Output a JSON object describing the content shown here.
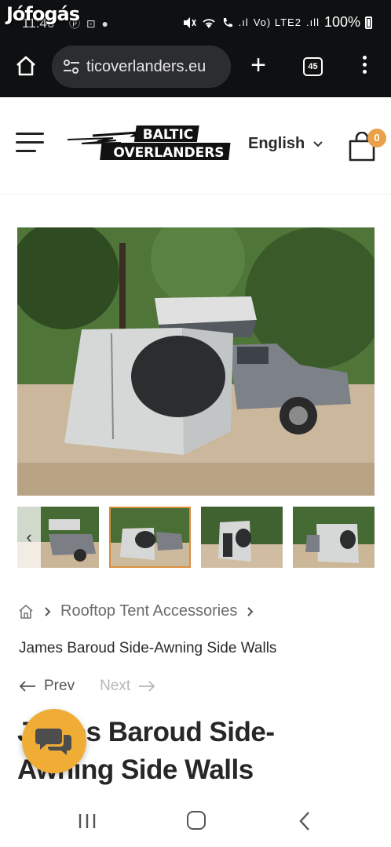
{
  "status_bar": {
    "watermark": "Jófogás",
    "time": "11:46",
    "left_icons": "ⓟ ⊡ ●",
    "network": "Vo) LTE2",
    "battery": "100%"
  },
  "browser": {
    "url": "ticoverlanders.eu",
    "tab_count": "45"
  },
  "header": {
    "logo_line1": "BALTIC",
    "logo_line2": "OVERLANDERS",
    "language": "English",
    "cart_count": "0"
  },
  "gallery": {
    "thumbnail_count": 4,
    "active_thumbnail": 2
  },
  "breadcrumb": {
    "category": "Rooftop Tent Accessories"
  },
  "product": {
    "subtitle": "James Baroud Side-Awning Side Walls",
    "title": "James Baroud Side-Awning Side Walls"
  },
  "pager": {
    "prev": "Prev",
    "next": "Next"
  },
  "colors": {
    "accent": "#e9a24a",
    "chat_button": "#f0ad36",
    "chrome_bg": "#0f1011"
  },
  "icons": [
    "home-icon",
    "tune-icon",
    "plus-icon",
    "tabs-icon",
    "menu-dots-icon",
    "hamburger-icon",
    "chevron-down-icon",
    "cart-icon",
    "chevron-left-icon",
    "breadcrumb-home-icon",
    "chevron-right-icon",
    "arrow-left-icon",
    "arrow-right-icon",
    "chat-icon",
    "recent-apps-icon",
    "nav-home-icon",
    "nav-back-icon"
  ]
}
